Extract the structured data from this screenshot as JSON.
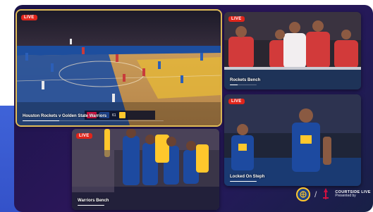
{
  "colors": {
    "accent_gold": "#e1bd58",
    "live_red": "#e0251b",
    "panel_bg": "#231a58",
    "page_blue": "#3f63d8"
  },
  "tiles": [
    {
      "id": "main-broadcast",
      "live_label": "LIVE",
      "caption": "Houston Rockets v Golden State Warriors",
      "selected": true,
      "progress": 0.26
    },
    {
      "id": "rockets-bench",
      "live_label": "LIVE",
      "caption": "Rockets Bench",
      "selected": false,
      "progress": 0.35
    },
    {
      "id": "warriors-bench",
      "live_label": "LIVE",
      "caption": "Warriors Bench",
      "selected": false,
      "progress": 0.3
    },
    {
      "id": "locked-on-steph",
      "live_label": "LIVE",
      "caption": "Locked On Steph",
      "selected": false,
      "progress": 0.3
    }
  ],
  "scorebug": {
    "score": "61"
  },
  "brand": {
    "warriors_icon": "warriors-logo-icon",
    "rockets_icon": "rockets-logo-icon",
    "title": "COURTSIDE LIVE",
    "subtitle": "Presented by"
  }
}
